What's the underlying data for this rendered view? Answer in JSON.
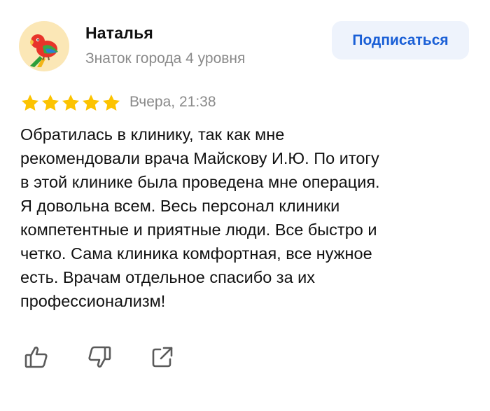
{
  "author": {
    "name": "Наталья",
    "level": "Знаток города 4 уровня",
    "avatar_icon": "parrot-icon"
  },
  "subscribe_label": "Подписаться",
  "rating": {
    "value": 5,
    "max": 5,
    "star_color": "#fcc300"
  },
  "date": "Вчера, 21:38",
  "review_text": "Обратилась в клинику, так как мне\nрекомендовали врача Майскову И.Ю.  По итогу\nв этой клинике была проведена мне операция.\nЯ довольна всем. Весь персонал клиники\nкомпетентные и приятные люди. Все быстро и\nчетко. Сама клиника комфортная, все нужное\nесть. Врачам отдельное спасибо за их\nпрофессионализм!",
  "actions": [
    {
      "icon": "thumbs-up-icon"
    },
    {
      "icon": "thumbs-down-icon"
    },
    {
      "icon": "share-icon"
    }
  ],
  "colors": {
    "accent": "#1a5fd6",
    "button_bg": "#eef3fc",
    "muted_text": "#8a8a8a"
  }
}
